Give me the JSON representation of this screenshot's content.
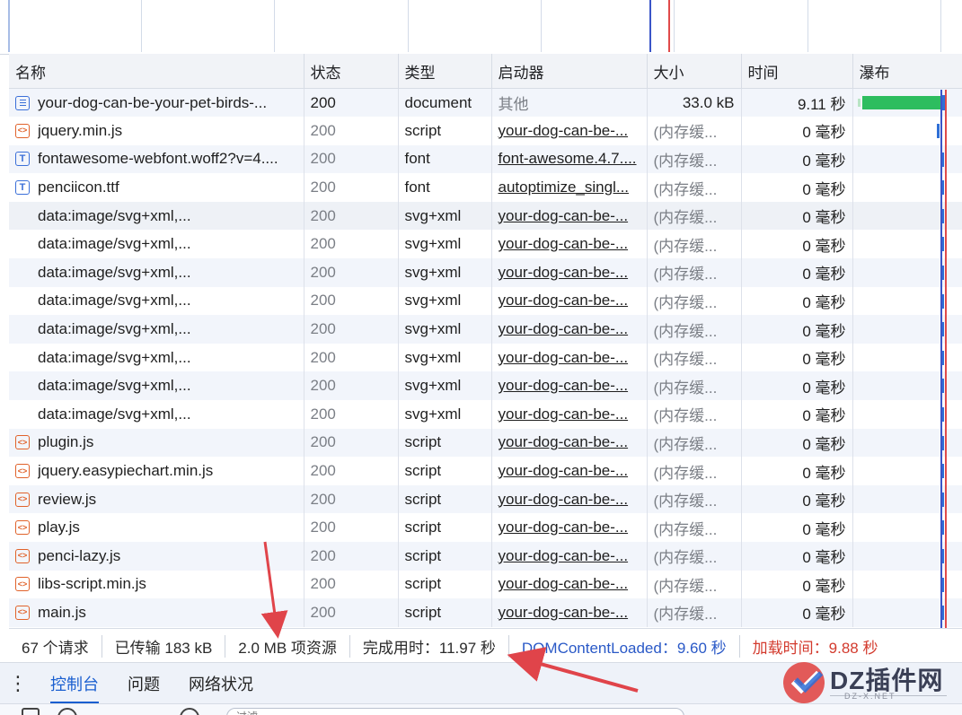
{
  "columns": {
    "name": "名称",
    "status": "状态",
    "type": "类型",
    "initiator": "启动器",
    "size": "大小",
    "time": "时间",
    "waterfall": "瀑布"
  },
  "rows": [
    {
      "icon": "document-icon",
      "name": "your-dog-can-be-your-pet-birds-...",
      "status": "200",
      "type": "document",
      "initiator": "其他",
      "size": "33.0 kB",
      "time": "9.11 秒"
    },
    {
      "icon": "script-icon",
      "name": "jquery.min.js",
      "status": "200",
      "type": "script",
      "initiator": "your-dog-can-be-...",
      "size": "(内存缓...",
      "time": "0 毫秒"
    },
    {
      "icon": "font-icon",
      "name": "fontawesome-webfont.woff2?v=4....",
      "status": "200",
      "type": "font",
      "initiator": "font-awesome.4.7....",
      "size": "(内存缓...",
      "time": "0 毫秒"
    },
    {
      "icon": "font-icon",
      "name": "penciicon.ttf",
      "status": "200",
      "type": "font",
      "initiator": "autoptimize_singl...",
      "size": "(内存缓...",
      "time": "0 毫秒"
    },
    {
      "icon": "",
      "name": "data:image/svg+xml,...",
      "status": "200",
      "type": "svg+xml",
      "initiator": "your-dog-can-be-...",
      "size": "(内存缓...",
      "time": "0 毫秒"
    },
    {
      "icon": "",
      "name": "data:image/svg+xml,...",
      "status": "200",
      "type": "svg+xml",
      "initiator": "your-dog-can-be-...",
      "size": "(内存缓...",
      "time": "0 毫秒"
    },
    {
      "icon": "",
      "name": "data:image/svg+xml,...",
      "status": "200",
      "type": "svg+xml",
      "initiator": "your-dog-can-be-...",
      "size": "(内存缓...",
      "time": "0 毫秒"
    },
    {
      "icon": "",
      "name": "data:image/svg+xml,...",
      "status": "200",
      "type": "svg+xml",
      "initiator": "your-dog-can-be-...",
      "size": "(内存缓...",
      "time": "0 毫秒"
    },
    {
      "icon": "",
      "name": "data:image/svg+xml,...",
      "status": "200",
      "type": "svg+xml",
      "initiator": "your-dog-can-be-...",
      "size": "(内存缓...",
      "time": "0 毫秒"
    },
    {
      "icon": "",
      "name": "data:image/svg+xml,...",
      "status": "200",
      "type": "svg+xml",
      "initiator": "your-dog-can-be-...",
      "size": "(内存缓...",
      "time": "0 毫秒"
    },
    {
      "icon": "",
      "name": "data:image/svg+xml,...",
      "status": "200",
      "type": "svg+xml",
      "initiator": "your-dog-can-be-...",
      "size": "(内存缓...",
      "time": "0 毫秒"
    },
    {
      "icon": "",
      "name": "data:image/svg+xml,...",
      "status": "200",
      "type": "svg+xml",
      "initiator": "your-dog-can-be-...",
      "size": "(内存缓...",
      "time": "0 毫秒"
    },
    {
      "icon": "script-icon",
      "name": "plugin.js",
      "status": "200",
      "type": "script",
      "initiator": "your-dog-can-be-...",
      "size": "(内存缓...",
      "time": "0 毫秒"
    },
    {
      "icon": "script-icon",
      "name": "jquery.easypiechart.min.js",
      "status": "200",
      "type": "script",
      "initiator": "your-dog-can-be-...",
      "size": "(内存缓...",
      "time": "0 毫秒"
    },
    {
      "icon": "script-icon",
      "name": "review.js",
      "status": "200",
      "type": "script",
      "initiator": "your-dog-can-be-...",
      "size": "(内存缓...",
      "time": "0 毫秒"
    },
    {
      "icon": "script-icon",
      "name": "play.js",
      "status": "200",
      "type": "script",
      "initiator": "your-dog-can-be-...",
      "size": "(内存缓...",
      "time": "0 毫秒"
    },
    {
      "icon": "script-icon",
      "name": "penci-lazy.js",
      "status": "200",
      "type": "script",
      "initiator": "your-dog-can-be-...",
      "size": "(内存缓...",
      "time": "0 毫秒"
    },
    {
      "icon": "script-icon",
      "name": "libs-script.min.js",
      "status": "200",
      "type": "script",
      "initiator": "your-dog-can-be-...",
      "size": "(内存缓...",
      "time": "0 毫秒"
    },
    {
      "icon": "script-icon",
      "name": "main.js",
      "status": "200",
      "type": "script",
      "initiator": "your-dog-can-be-...",
      "size": "(内存缓...",
      "time": "0 毫秒"
    }
  ],
  "summary": {
    "requests": "67 个请求",
    "transferred": "已传输 183 kB",
    "resources": "2.0 MB 项资源",
    "finish": "完成用时：11.97 秒",
    "dom_content_loaded": "DOMContentLoaded：9.60 秒",
    "load": "加载时间：9.88 秒"
  },
  "drawer": {
    "menu_icon": "more-vertical-icon",
    "tabs": [
      "控制台",
      "问题",
      "网络状况"
    ],
    "active_tab": "控制台",
    "filter_placeholder": "过滤"
  },
  "watermark": {
    "text": "DZ插件网",
    "sub": "DZ-X.NET"
  },
  "colors": {
    "waterfall_green": "#2dbd5f",
    "waterfall_blue": "#2f6fd6",
    "load_red": "#d33b2e",
    "dcl_blue": "#2a59c7",
    "annotation_red": "#e0444a"
  }
}
